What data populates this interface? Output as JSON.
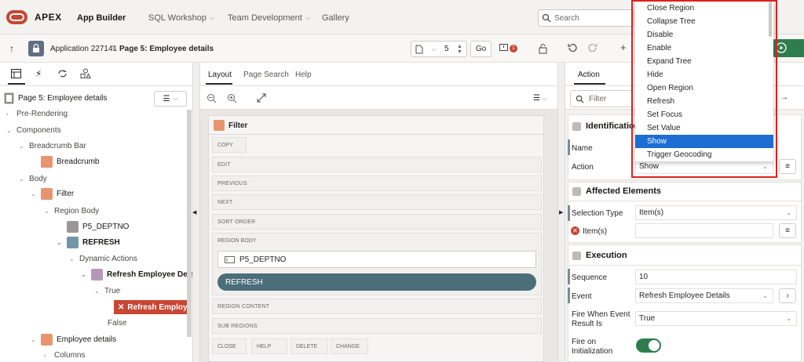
{
  "topbar": {
    "brand": "APEX",
    "nav": [
      {
        "label": "App Builder",
        "active": true
      },
      {
        "label": "SQL Workshop",
        "caret": true
      },
      {
        "label": "Team Development",
        "caret": true
      },
      {
        "label": "Gallery"
      }
    ],
    "search_placeholder": "Search"
  },
  "appbar": {
    "application": "Application 227141",
    "page": "Page 5: Employee details",
    "page_number": "5",
    "go_label": "Go",
    "issues_count": "1",
    "plus": "+"
  },
  "left": {
    "tabs": [
      "rendering-tab",
      "dynamic-actions-tab",
      "processing-tab",
      "shared-components-tab"
    ],
    "page_title": "Page 5: Employee details",
    "tree": [
      {
        "label": "Pre-Rendering",
        "level": 0
      },
      {
        "label": "Components",
        "level": 0
      },
      {
        "label": "Breadcrumb Bar",
        "level": 1
      },
      {
        "label": "Breadcrumb",
        "level": 2,
        "icon": "breadcrumb-icon"
      },
      {
        "label": "Body",
        "level": 1
      },
      {
        "label": "Filter",
        "level": 2,
        "icon": "region-icon"
      },
      {
        "label": "Region Body",
        "level": 3
      },
      {
        "label": "P5_DEPTNO",
        "level": 4,
        "icon": "item-icon"
      },
      {
        "label": "REFRESH",
        "level": 4,
        "icon": "button-icon"
      },
      {
        "label": "Dynamic Actions",
        "level": 5
      },
      {
        "label": "Refresh Employee Details",
        "level": 6,
        "icon": "dynamic-action-icon"
      },
      {
        "label": "True",
        "level": 7
      },
      {
        "label": "Refresh Employe",
        "level": 8,
        "icon": "action-icon"
      },
      {
        "label": "False",
        "level": 7
      },
      {
        "label": "Employee details",
        "level": 2,
        "icon": "report-icon"
      },
      {
        "label": "Columns",
        "level": 3
      }
    ]
  },
  "middle": {
    "tabs": [
      "Layout",
      "Page Search",
      "Help"
    ],
    "region_title": "Filter",
    "slots": {
      "copy": "COPY",
      "edit": "EDIT",
      "previous": "PREVIOUS",
      "next": "NEXT",
      "sort_order": "SORT ORDER",
      "region_body": "REGION BODY",
      "region_content": "REGION CONTENT",
      "sub_regions": "SUB REGIONS",
      "close": "CLOSE",
      "help": "HELP",
      "delete": "DELETE",
      "change": "CHANGE"
    },
    "item_label": "P5_DEPTNO",
    "button_label": "REFRESH"
  },
  "right": {
    "tab": "Action",
    "filter_placeholder": "Filter",
    "identification": {
      "title": "Identification",
      "name_label": "Name",
      "action_label": "Action",
      "action_value": "Show"
    },
    "affected": {
      "title": "Affected Elements",
      "selection_type_label": "Selection Type",
      "selection_type_value": "Item(s)",
      "items_label": "Item(s)"
    },
    "execution": {
      "title": "Execution",
      "sequence_label": "Sequence",
      "sequence_value": "10",
      "event_label": "Event",
      "event_value": "Refresh Employee Details",
      "fire_when_label_1": "Fire When Event",
      "fire_when_label_2": "Result Is",
      "fire_when_value": "True",
      "fire_init_label_1": "Fire on",
      "fire_init_label_2": "Initialization",
      "fire_init_value": true
    }
  },
  "dropdown": {
    "items": [
      "Close Region",
      "Collapse Tree",
      "Disable",
      "Enable",
      "Expand Tree",
      "Hide",
      "Open Region",
      "Refresh",
      "Set Focus",
      "Set Value",
      "Show",
      "Trigger Geocoding"
    ],
    "selected": "Show"
  },
  "colors": {
    "accent": "#c74634",
    "button_teal": "#4b6e7a",
    "select_blue": "#1d6dd2",
    "run_green": "#2e7d4f",
    "highlight_red": "#e0201b"
  }
}
